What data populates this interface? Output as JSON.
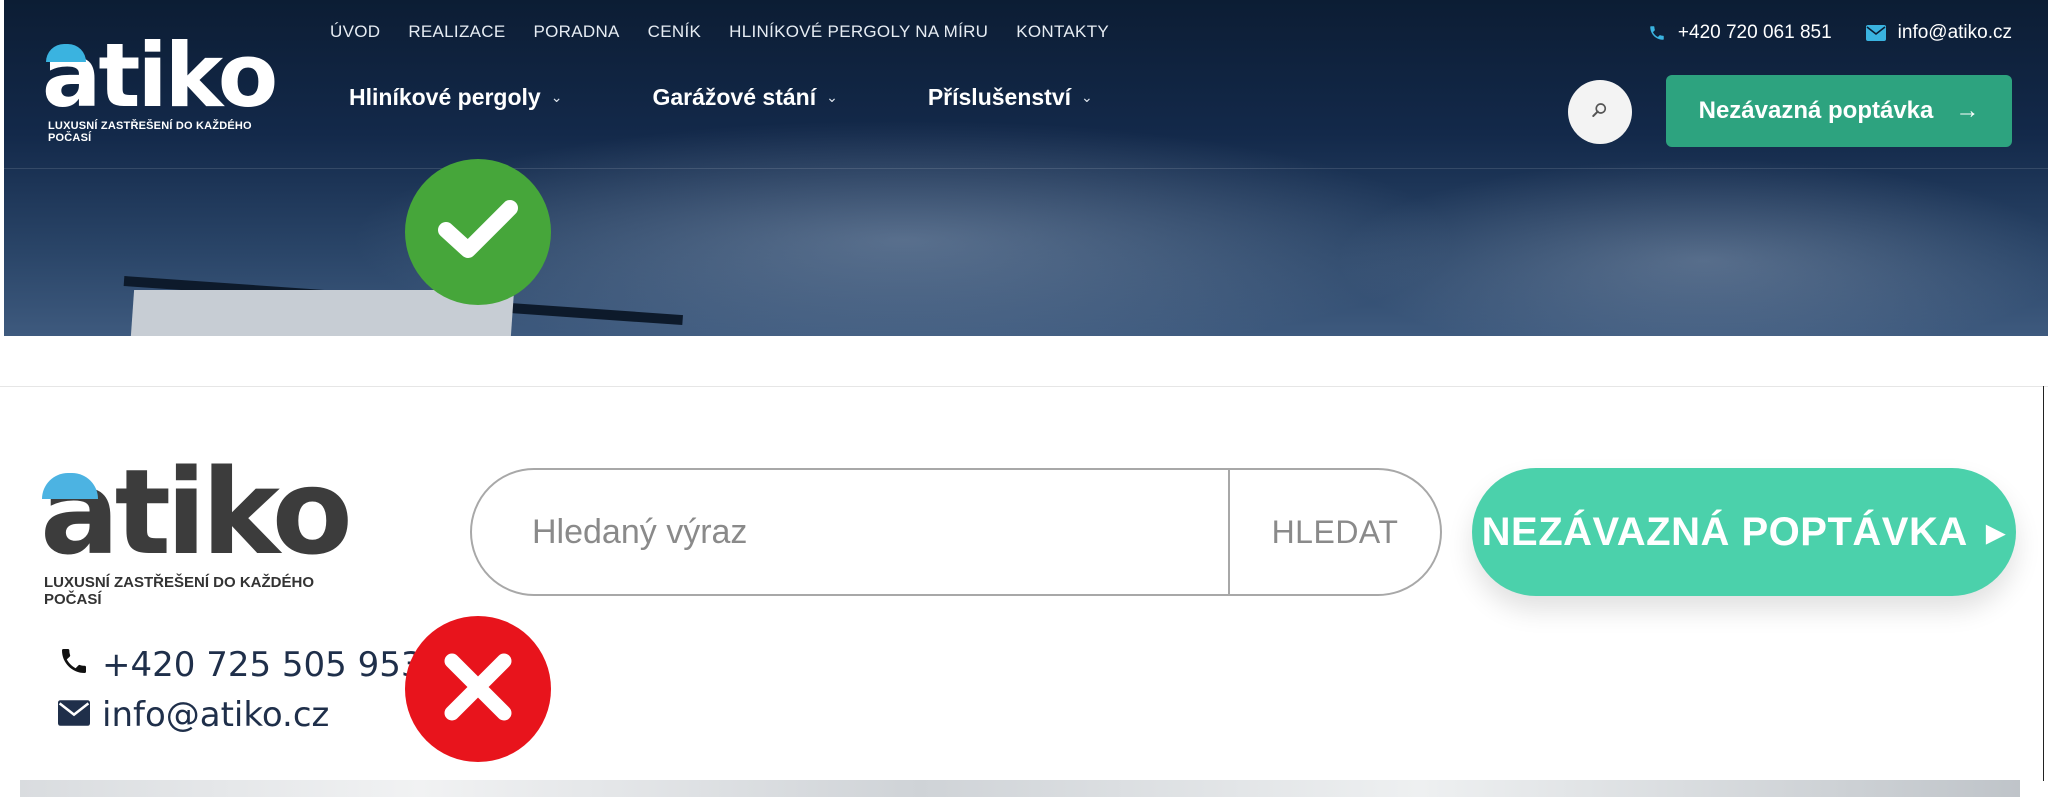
{
  "new_header": {
    "logo": {
      "word": "atiko",
      "tagline": "LUXUSNÍ ZASTŘEŠENÍ DO KAŽDÉHO POČASÍ"
    },
    "top_nav": [
      "ÚVOD",
      "REALIZACE",
      "PORADNA",
      "CENÍK",
      "HLINÍKOVÉ PERGOLY NA MÍRU",
      "KONTAKTY"
    ],
    "phone": "+420 720 061 851",
    "email": "info@atiko.cz",
    "main_nav": [
      {
        "label": "Hliníkové pergoly",
        "chevron": "⌄"
      },
      {
        "label": "Garážové stání",
        "chevron": "⌄"
      },
      {
        "label": "Příslušenství",
        "chevron": "⌄"
      }
    ],
    "cta_label": "Nezávazná poptávka",
    "cta_arrow": "→",
    "verdict_icon": "checkmark-icon",
    "colors": {
      "cta": "#2da37f",
      "accent_blue": "#3ab3e0",
      "ok": "#46a63a"
    }
  },
  "old_header": {
    "logo": {
      "word": "atiko",
      "tagline": "LUXUSNÍ ZASTŘEŠENÍ DO KAŽDÉHO POČASÍ"
    },
    "phone": "+420 725 505 953",
    "email": "info@atiko.cz",
    "search_placeholder": "Hledaný výraz",
    "search_button": "HLEDAT",
    "cta_label": "NEZÁVAZNÁ POPTÁVKA",
    "cta_arrow": "▸",
    "verdict_icon": "cross-icon",
    "colors": {
      "cta": "#4bd1ab",
      "bad": "#e8141c",
      "accent_blue": "#4cb3e2"
    }
  }
}
